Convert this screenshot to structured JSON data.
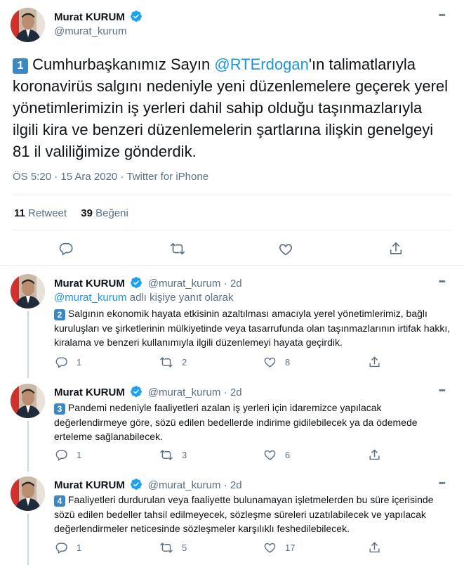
{
  "main_tweet": {
    "name": "Murat KURUM",
    "handle": "@murat_kurum",
    "more": "•••",
    "number_badge": "1",
    "text_before": "Cumhurbaşkanımız Sayın ",
    "mention": "@RTErdogan",
    "text_after": "'ın talimatlarıyla koronavirüs salgını nedeniyle yeni düzenlemelere geçerek yerel yönetimlerimizin iş yerleri dahil sahip olduğu taşınmazlarıyla ilgili kira ve benzeri düzenlemelerin şartlarına ilişkin genelgeyi 81 il valiliğimize gönderdik.",
    "meta": "ÖS 5:20 · 15 Ara 2020 · Twitter for iPhone",
    "retweet_count": "11",
    "retweet_label": "Retweet",
    "like_count": "39",
    "like_label": "Beğeni"
  },
  "replies": [
    {
      "name": "Murat KURUM",
      "handle": "@murat_kurum",
      "time": "· 2d",
      "more": "•••",
      "reply_to_handle": "@murat_kurum",
      "reply_to_suffix": " adlı kişiye yanıt olarak",
      "number_badge": "2",
      "text": "Salgının ekonomik hayata etkisinin azaltılması amacıyla yerel yönetimlerimiz, bağlı kuruluşları ve şirketlerinin mülkiyetinde veya tasarrufunda olan taşınmazlarının irtifak hakkı, kiralama ve benzeri kullanımıyla ilgili düzenlemeyi hayata geçirdik.",
      "replies": "1",
      "retweets": "2",
      "likes": "8"
    },
    {
      "name": "Murat KURUM",
      "handle": "@murat_kurum",
      "time": "· 2d",
      "more": "•••",
      "number_badge": "3",
      "text": "Pandemi nedeniyle faaliyetleri azalan iş yerleri için idaremizce yapılacak değerlendirmeye göre, sözü edilen bedellerde indirime gidilebilecek ya da ödemede erteleme sağlanabilecek.",
      "replies": "1",
      "retweets": "3",
      "likes": "6"
    },
    {
      "name": "Murat KURUM",
      "handle": "@murat_kurum",
      "time": "· 2d",
      "more": "•••",
      "number_badge": "4",
      "text": "Faaliyetleri durdurulan veya faaliyette bulunamayan işletmelerden bu süre içerisinde sözü edilen bedeller tahsil edilmeyecek, sözleşme süreleri uzatılabilecek ve yapılacak değerlendirmeler neticesinde sözleşmeler karşılıklı feshedilebilecek.",
      "replies": "1",
      "retweets": "5",
      "likes": "17"
    }
  ],
  "colors": {
    "link": "#1b95e0",
    "secondary": "#5b7083",
    "divider": "#e6ecf0",
    "verified": "#1da1f2",
    "badge": "#3b88c3"
  },
  "icons": [
    "verified-badge-icon",
    "reply-icon",
    "retweet-icon",
    "like-icon",
    "share-icon",
    "more-icon"
  ]
}
